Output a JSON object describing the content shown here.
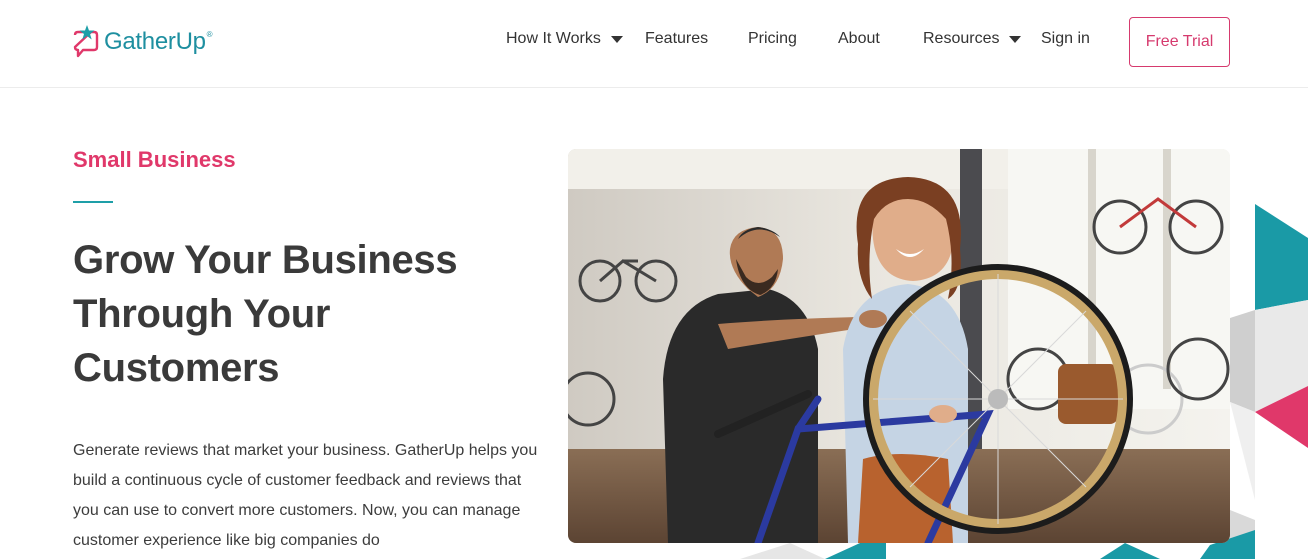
{
  "brand": {
    "name": "GatherUp",
    "tm": "®",
    "colors": {
      "teal": "#1e8fa0",
      "pink": "#e0386a",
      "dark": "#3a3a3a"
    }
  },
  "nav": {
    "items": [
      {
        "label": "How It Works",
        "has_dropdown": true
      },
      {
        "label": "Features",
        "has_dropdown": false
      },
      {
        "label": "Pricing",
        "has_dropdown": false
      },
      {
        "label": "About",
        "has_dropdown": false
      },
      {
        "label": "Resources",
        "has_dropdown": true
      },
      {
        "label": "Sign in",
        "has_dropdown": false
      }
    ],
    "cta": "Free Trial"
  },
  "hero": {
    "eyebrow": "Small Business",
    "headline": "Grow Your Business Through Your Customers",
    "body": "Generate reviews that market your business. GatherUp helps you build a continuous cycle of customer feedback and reviews that you can use to convert more customers. Now, you can manage customer experience like big companies do",
    "image": "photo-bike-shop-customers"
  }
}
